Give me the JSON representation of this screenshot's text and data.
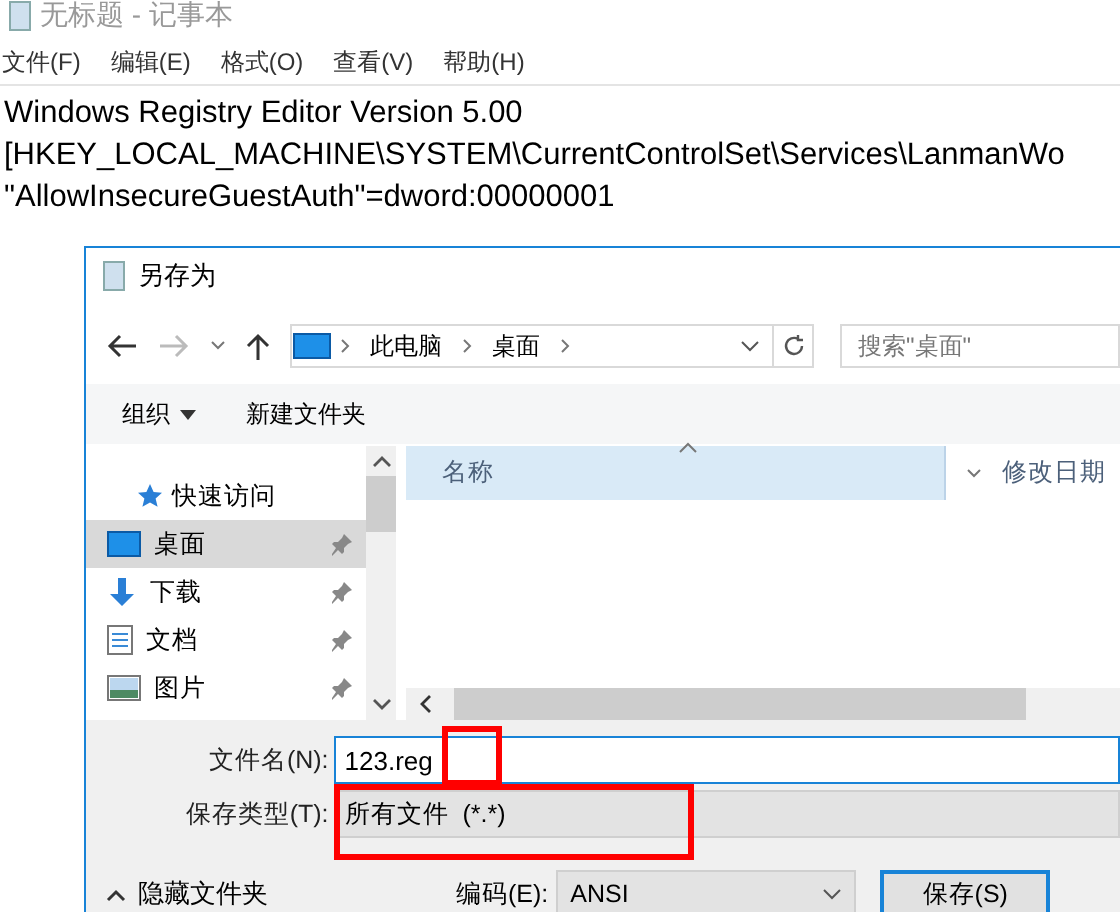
{
  "notepad": {
    "title": "无标题 - 记事本",
    "menu": [
      "文件(F)",
      "编辑(E)",
      "格式(O)",
      "查看(V)",
      "帮助(H)"
    ],
    "lines": [
      "Windows Registry Editor Version 5.00",
      "[HKEY_LOCAL_MACHINE\\SYSTEM\\CurrentControlSet\\Services\\LanmanWo",
      "\"AllowInsecureGuestAuth\"=dword:00000001"
    ]
  },
  "dialog": {
    "title": "另存为",
    "breadcrumb": [
      "此电脑",
      "桌面"
    ],
    "search": {
      "placeholder": "搜索\"桌面\""
    },
    "toolbar": [
      {
        "label": "组织",
        "kind": "menu"
      },
      {
        "label": "新建文件夹",
        "kind": "button"
      }
    ],
    "nav": [
      {
        "label": "快速访问",
        "kind": "star",
        "selected": false,
        "pinned": false
      },
      {
        "label": "桌面",
        "kind": "desktop",
        "selected": true,
        "pinned": true
      },
      {
        "label": "下载",
        "kind": "download",
        "selected": false,
        "pinned": true
      },
      {
        "label": "文档",
        "kind": "document",
        "selected": false,
        "pinned": true
      },
      {
        "label": "图片",
        "kind": "pictures",
        "selected": false,
        "pinned": true
      }
    ],
    "columns": [
      "名称",
      "修改日期"
    ],
    "filename": {
      "label": "文件名(N):",
      "value": "123.reg"
    },
    "filetype": {
      "label": "保存类型(T):",
      "value": "所有文件  (*.*)"
    },
    "hide_folders": "隐藏文件夹",
    "encoding": {
      "label": "编码(E):",
      "value": "ANSI"
    },
    "buttons": [
      "保存(S)"
    ]
  }
}
